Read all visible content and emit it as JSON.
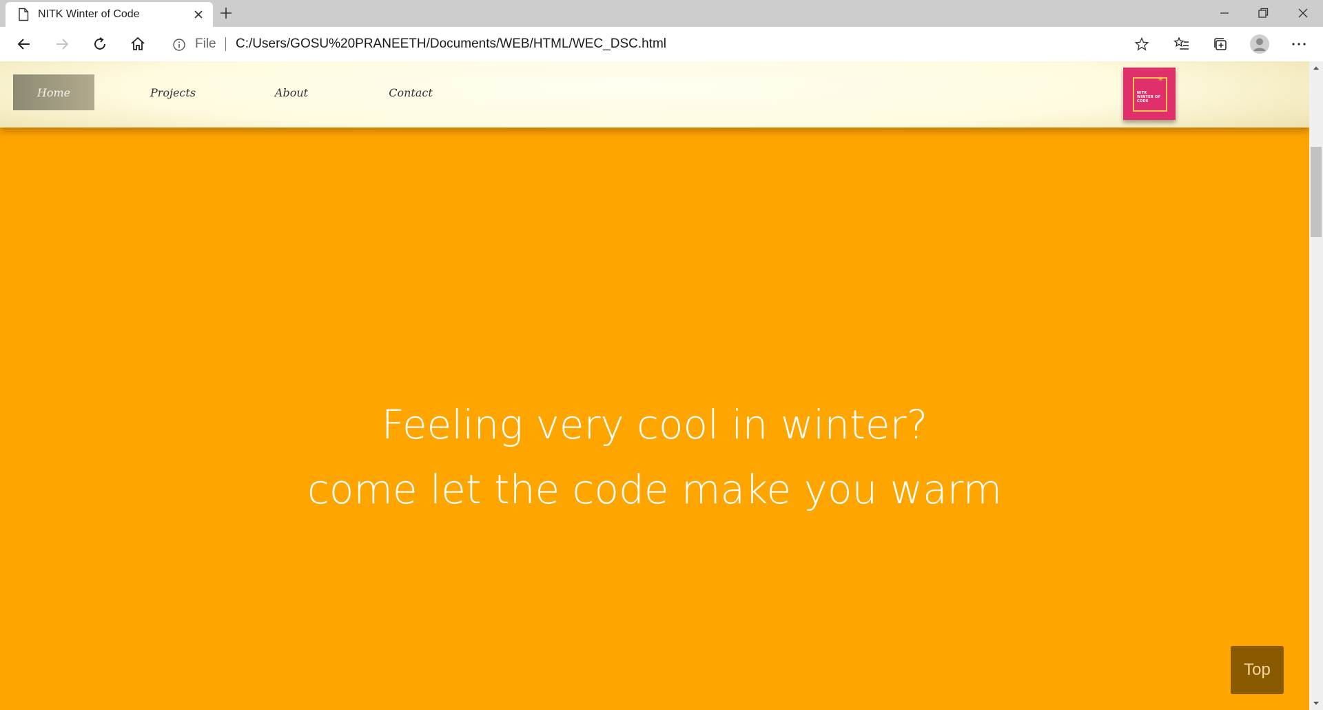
{
  "browser": {
    "tab_title": "NITK Winter of Code",
    "address": {
      "scheme_label": "File",
      "url": "C:/Users/GOSU%20PRANEETH/Documents/WEB/HTML/WEC_DSC.html"
    },
    "icons": {
      "tab": "document-icon",
      "tab_close": "close-icon",
      "new_tab": "plus-icon",
      "minimize": "minimize-icon",
      "restore": "restore-icon",
      "close_window": "close-icon",
      "back": "back-arrow-icon",
      "forward": "forward-arrow-icon",
      "refresh": "refresh-icon",
      "home": "home-icon",
      "site_info": "info-icon",
      "favorite": "star-icon",
      "favorites_list": "favorites-icon",
      "collections": "collections-icon",
      "profile": "profile-icon",
      "more": "more-icon"
    }
  },
  "page": {
    "nav": {
      "items": [
        {
          "label": "Home",
          "active": true
        },
        {
          "label": "Projects",
          "active": false
        },
        {
          "label": "About",
          "active": false
        },
        {
          "label": "Contact",
          "active": false
        }
      ],
      "logo_text": "NITK WINTER OF CODE"
    },
    "hero": {
      "line1": "Feeling very cool in winter?",
      "line2": "come let the code make you warm"
    },
    "top_button_label": "Top",
    "colors": {
      "background": "#ffa500",
      "top_button": "#8a5a00",
      "logo": "#e0306b",
      "logo_accent": "#f3c74a"
    }
  }
}
